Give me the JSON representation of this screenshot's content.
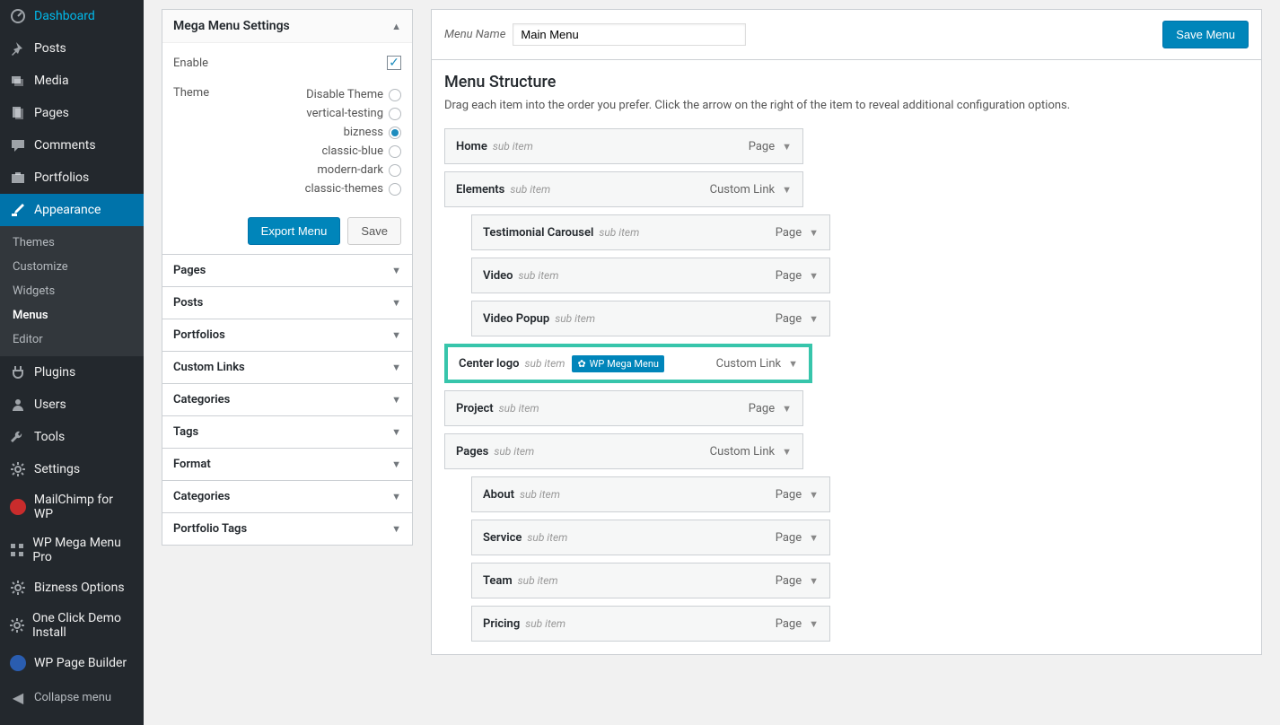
{
  "sidebar": {
    "items": [
      {
        "label": "Dashboard",
        "icon": "dashboard"
      },
      {
        "label": "Posts",
        "icon": "pin"
      },
      {
        "label": "Media",
        "icon": "media"
      },
      {
        "label": "Pages",
        "icon": "pages"
      },
      {
        "label": "Comments",
        "icon": "comment"
      },
      {
        "label": "Portfolios",
        "icon": "portfolio"
      },
      {
        "label": "Appearance",
        "icon": "brush",
        "active": true
      },
      {
        "label": "Plugins",
        "icon": "plug"
      },
      {
        "label": "Users",
        "icon": "user"
      },
      {
        "label": "Tools",
        "icon": "wrench"
      },
      {
        "label": "Settings",
        "icon": "gear"
      },
      {
        "label": "MailChimp for WP",
        "icon": "mc"
      },
      {
        "label": "WP Mega Menu Pro",
        "icon": "grid"
      },
      {
        "label": "Bizness Options",
        "icon": "gear"
      },
      {
        "label": "One Click Demo Install",
        "icon": "gear"
      },
      {
        "label": "WP Page Builder",
        "icon": "pb"
      }
    ],
    "sub_appearance": [
      "Themes",
      "Customize",
      "Widgets",
      "Menus",
      "Editor"
    ],
    "current_sub": "Menus",
    "collapse_label": "Collapse menu"
  },
  "mega_settings": {
    "title": "Mega Menu Settings",
    "enable_label": "Enable",
    "enable_checked": true,
    "theme_label": "Theme",
    "themes": [
      {
        "label": "Disable Theme",
        "selected": false
      },
      {
        "label": "vertical-testing",
        "selected": false
      },
      {
        "label": "bizness",
        "selected": true
      },
      {
        "label": "classic-blue",
        "selected": false
      },
      {
        "label": "modern-dark",
        "selected": false
      },
      {
        "label": "classic-themes",
        "selected": false
      }
    ],
    "export_btn": "Export Menu",
    "save_btn": "Save"
  },
  "accordion": [
    "Pages",
    "Posts",
    "Portfolios",
    "Custom Links",
    "Categories",
    "Tags",
    "Format",
    "Categories",
    "Portfolio Tags"
  ],
  "top": {
    "menu_name_label": "Menu Name",
    "menu_name_value": "Main Menu",
    "save_menu": "Save Menu"
  },
  "panel": {
    "title": "Menu Structure",
    "help": "Drag each item into the order you prefer. Click the arrow on the right of the item to reveal additional configuration options."
  },
  "badge_label": "WP Mega Menu",
  "sub_item_label": "sub item",
  "menu_items": [
    {
      "title": "Home",
      "type": "Page",
      "indent": 0
    },
    {
      "title": "Elements",
      "type": "Custom Link",
      "indent": 0
    },
    {
      "title": "Testimonial Carousel",
      "type": "Page",
      "indent": 1
    },
    {
      "title": "Video",
      "type": "Page",
      "indent": 1
    },
    {
      "title": "Video Popup",
      "type": "Page",
      "indent": 1
    },
    {
      "title": "Center logo",
      "type": "Custom Link",
      "indent": 0,
      "highlight": true,
      "badge": true
    },
    {
      "title": "Project",
      "type": "Page",
      "indent": 0
    },
    {
      "title": "Pages",
      "type": "Custom Link",
      "indent": 0
    },
    {
      "title": "About",
      "type": "Page",
      "indent": 1
    },
    {
      "title": "Service",
      "type": "Page",
      "indent": 1
    },
    {
      "title": "Team",
      "type": "Page",
      "indent": 1
    },
    {
      "title": "Pricing",
      "type": "Page",
      "indent": 1
    }
  ]
}
